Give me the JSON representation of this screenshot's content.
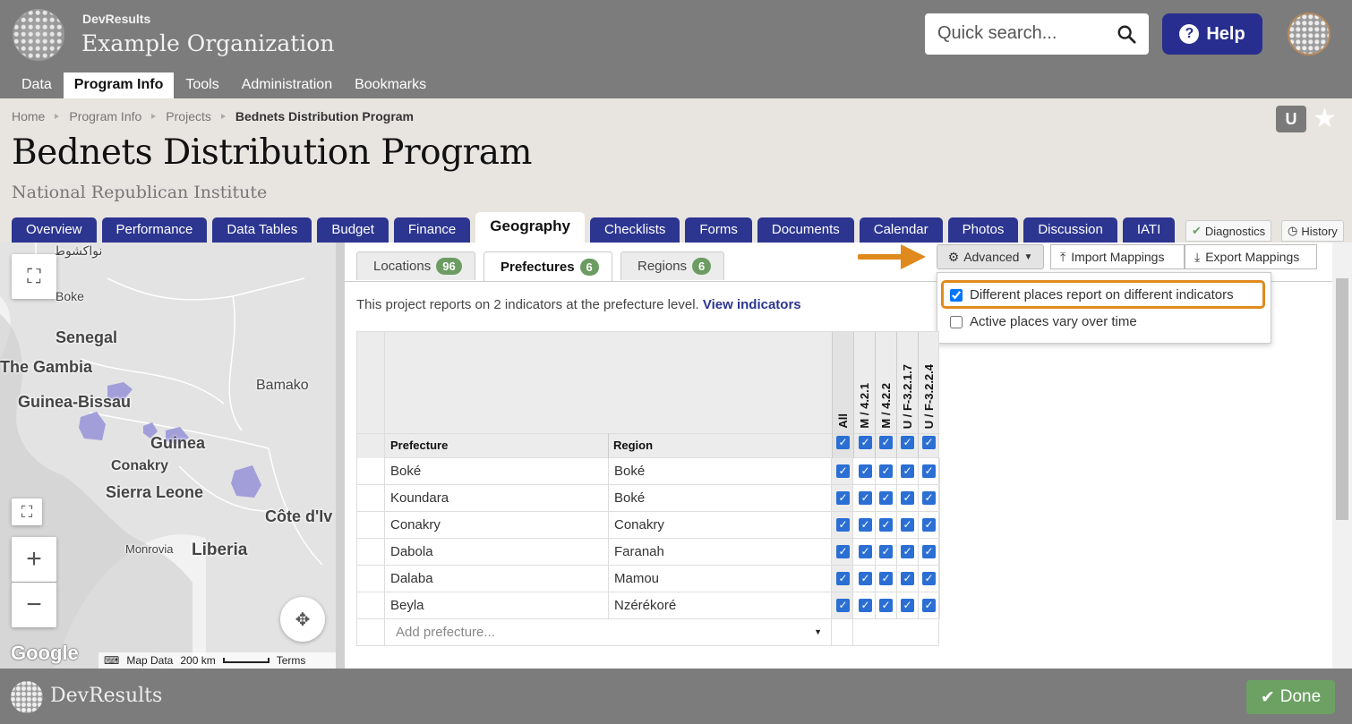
{
  "brand": {
    "app_name": "DevResults",
    "org_name": "Example Organization",
    "footer_name": "DevResults"
  },
  "search": {
    "placeholder": "Quick search..."
  },
  "help": {
    "label": "Help"
  },
  "main_nav": [
    {
      "label": "Data",
      "active": false
    },
    {
      "label": "Program Info",
      "active": true
    },
    {
      "label": "Tools",
      "active": false
    },
    {
      "label": "Administration",
      "active": false
    },
    {
      "label": "Bookmarks",
      "active": false
    }
  ],
  "breadcrumb": [
    "Home",
    "Program Info",
    "Projects",
    "Bednets Distribution Program"
  ],
  "page": {
    "title": "Bednets Distribution Program",
    "subtitle": "National Republican Institute",
    "user_badge": "U"
  },
  "project_tabs": [
    "Overview",
    "Performance",
    "Data Tables",
    "Budget",
    "Finance",
    "Geography",
    "Checklists",
    "Forms",
    "Documents",
    "Calendar",
    "Photos",
    "Discussion",
    "IATI"
  ],
  "active_tab": "Geography",
  "side_buttons": {
    "diagnostics": "Diagnostics",
    "history": "History"
  },
  "map": {
    "labels": [
      "Senegal",
      "The Gambia",
      "Guinea-Bissau",
      "Bamako",
      "Guinea",
      "Conakry",
      "Sierra Leone",
      "Côte d'Iv",
      "Liberia",
      "Monrovia",
      "Boke",
      "نواكشوط"
    ],
    "attribution": {
      "map_data": "Map Data",
      "scale": "200 km",
      "terms": "Terms"
    },
    "provider": "Google"
  },
  "sub_tabs": [
    {
      "label": "Locations",
      "count": "96"
    },
    {
      "label": "Prefectures",
      "count": "6"
    },
    {
      "label": "Regions",
      "count": "6"
    }
  ],
  "info": {
    "text": "This project reports on 2 indicators at the prefecture level.",
    "link": "View indicators"
  },
  "toolbar": {
    "advanced": "Advanced",
    "import": "Import Mappings",
    "export": "Export Mappings"
  },
  "advanced_menu": [
    {
      "label": "Different places report on different indicators",
      "checked": true
    },
    {
      "label": "Active places vary over time",
      "checked": false
    }
  ],
  "grid": {
    "columns": {
      "prefecture": "Prefecture",
      "region": "Region"
    },
    "indicator_columns": [
      "All",
      "M / 4.2.1",
      "M / 4.2.2",
      "U / F-3.2.1.7",
      "U / F-3.2.2.4"
    ],
    "rows": [
      {
        "prefecture": "Boké",
        "region": "Boké"
      },
      {
        "prefecture": "Koundara",
        "region": "Boké"
      },
      {
        "prefecture": "Conakry",
        "region": "Conakry"
      },
      {
        "prefecture": "Dabola",
        "region": "Faranah"
      },
      {
        "prefecture": "Dalaba",
        "region": "Mamou"
      },
      {
        "prefecture": "Beyla",
        "region": "Nzérékoré"
      }
    ],
    "add_placeholder": "Add prefecture..."
  },
  "footer": {
    "done": "Done"
  },
  "colors": {
    "nav_blue": "#2c3590",
    "header_gray": "#7c7c7c",
    "badge_green": "#6c9c62",
    "highlight_orange": "#e08a1e",
    "checkbox_blue": "#2b6fd4"
  }
}
